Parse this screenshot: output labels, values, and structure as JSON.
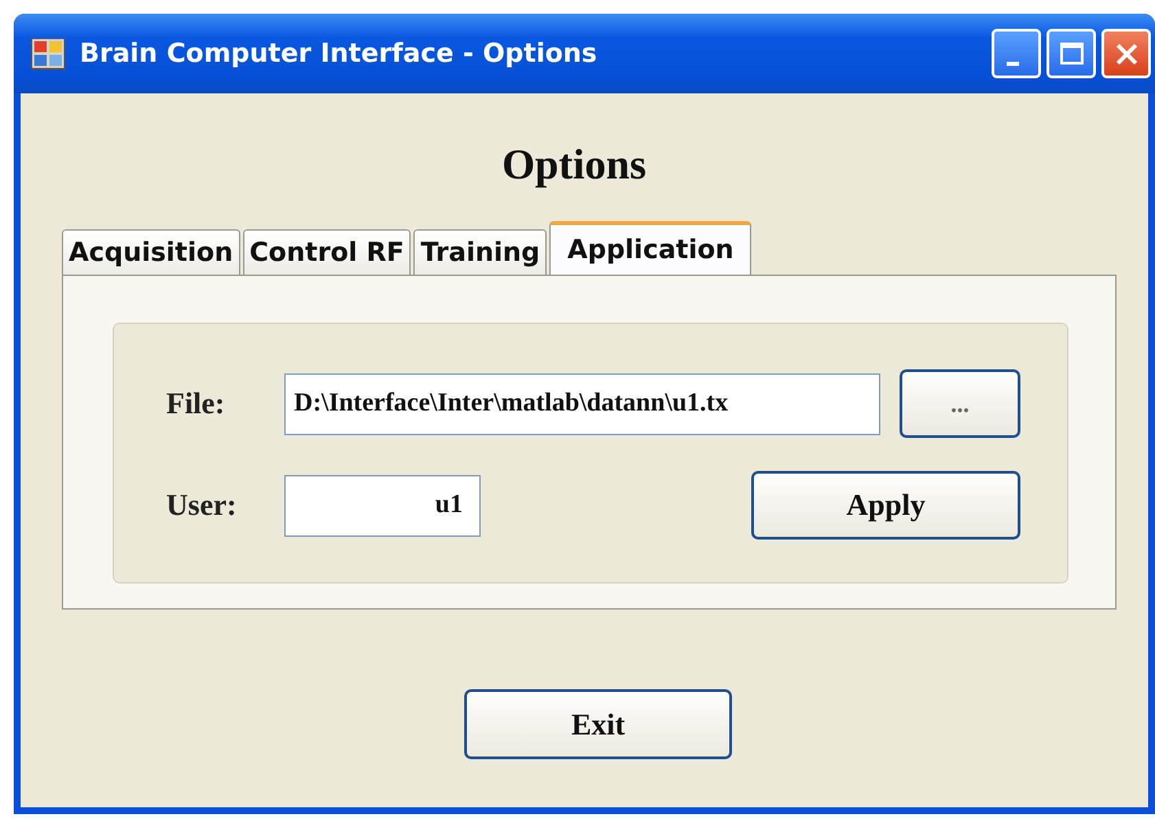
{
  "window": {
    "title": "Brain Computer Interface - Options",
    "controls": [
      {
        "kind": "minimize"
      },
      {
        "kind": "maximize"
      },
      {
        "kind": "close"
      }
    ]
  },
  "heading": "Options",
  "tabs": [
    {
      "label": "Acquisition",
      "selected": false
    },
    {
      "label": "Control RF",
      "selected": false
    },
    {
      "label": "Training",
      "selected": false
    },
    {
      "label": "Application",
      "selected": true
    }
  ],
  "file": {
    "label": "File:",
    "value": "D:\\Interface\\Inter\\matlab\\datann\\u1.tx",
    "browse_button": "..."
  },
  "user": {
    "label": "User:",
    "value": "u1"
  },
  "apply_button": "Apply",
  "exit_button": "Exit"
}
